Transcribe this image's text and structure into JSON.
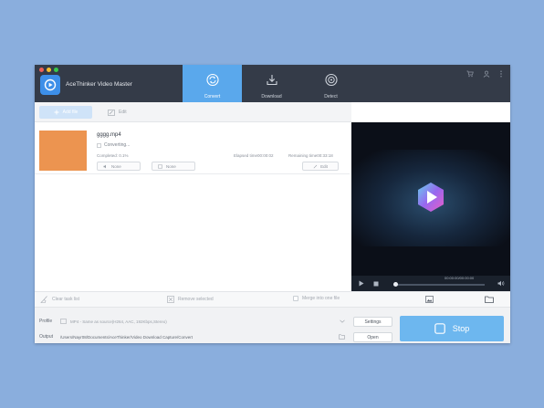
{
  "app": {
    "title": "AceThinker Video Master",
    "accent_color": "#5aa8ec"
  },
  "nav": {
    "tabs": [
      {
        "label": "Convert",
        "icon": "convert-icon",
        "active": true
      },
      {
        "label": "Download",
        "icon": "download-icon",
        "active": false
      },
      {
        "label": "Detect",
        "icon": "detect-icon",
        "active": false
      }
    ],
    "top_icons": [
      "cart-icon",
      "user-icon",
      "more-icon"
    ]
  },
  "toolbar": {
    "add_file_label": "Add file",
    "edit_label": "Edit"
  },
  "task": {
    "filename": "gggg.mp4",
    "status": "Converting...",
    "completed": "Completed: 0.1%",
    "elapsed": "Elapsed time00:00:02",
    "remaining": "Remaining time00:33:18",
    "audio_option": "None",
    "subtitle_option": "None",
    "edit_label": "Edit"
  },
  "player": {
    "timecode": "00:00:00/00:00:00"
  },
  "actions": {
    "clear_label": "Clear task list",
    "remove_label": "Remove selected",
    "merge_label": "Merge into one file"
  },
  "footer": {
    "profile_label": "Profile",
    "profile_value": "MP4 - Same as source(H264, AAC, 192Kbps,Stereo)",
    "output_label": "Output",
    "output_path": "/Users/Nayr08/Documents/AceThinker/Video Download Capture/Convert",
    "settings_label": "Settings",
    "open_label": "Open",
    "stop_label": "Stop"
  }
}
